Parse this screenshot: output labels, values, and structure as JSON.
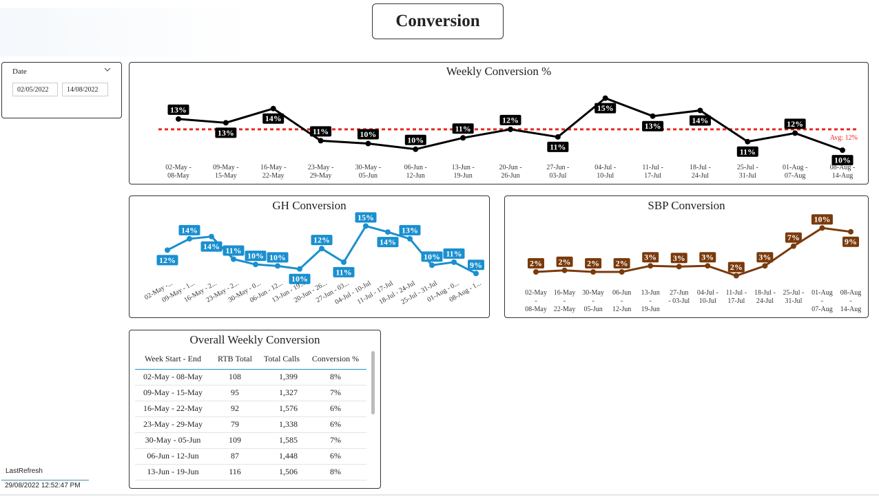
{
  "page": {
    "title": "Conversion"
  },
  "slicer": {
    "label": "Date",
    "start": "02/05/2022",
    "end": "14/08/2022"
  },
  "colors": {
    "weekly": "#000000",
    "avg": "#e8281e",
    "gh": "#1a8fcf",
    "sbp": "#7a3a0c"
  },
  "weekly_chart": {
    "title": "Weekly Conversion %",
    "avg_label": "Avg: 12%"
  },
  "gh_chart": {
    "title": "GH Conversion"
  },
  "sbp_chart": {
    "title": "SBP Conversion"
  },
  "table": {
    "title": "Overall Weekly Conversion",
    "columns": [
      "Week Start - End",
      "RTB Total",
      "Total Calls",
      "Conversion %"
    ],
    "rows": [
      [
        "02-May - 08-May",
        "108",
        "1,399",
        "8%"
      ],
      [
        "09-May - 15-May",
        "95",
        "1,327",
        "7%"
      ],
      [
        "16-May - 22-May",
        "92",
        "1,576",
        "6%"
      ],
      [
        "23-May - 29-May",
        "79",
        "1,338",
        "6%"
      ],
      [
        "30-May - 05-Jun",
        "109",
        "1,585",
        "7%"
      ],
      [
        "06-Jun - 12-Jun",
        "87",
        "1,448",
        "6%"
      ],
      [
        "13-Jun - 19-Jun",
        "116",
        "1,506",
        "8%"
      ]
    ]
  },
  "last_refresh": {
    "label": "LastRefresh",
    "value": "29/08/2022 12:52:47 PM"
  },
  "chart_data": [
    {
      "type": "line",
      "title": "Weekly Conversion %",
      "categories": [
        "02-May - 08-May",
        "09-May - 15-May",
        "16-May - 22-May",
        "23-May - 29-May",
        "30-May - 05-Jun",
        "06-Jun - 12-Jun",
        "13-Jun - 19-Jun",
        "20-Jun - 26-Jun",
        "27-Jun - 03-Jul",
        "04-Jul - 10-Jul",
        "11-Jul - 17-Jul",
        "18-Jul - 24-Jul",
        "25-Jul - 31-Jul",
        "01-Aug - 07-Aug",
        "08-Aug - 14-Aug"
      ],
      "cat_lines": [
        [
          "02-May -",
          "08-May"
        ],
        [
          "09-May -",
          "15-May"
        ],
        [
          "16-May -",
          "22-May"
        ],
        [
          "23-May -",
          "29-May"
        ],
        [
          "30-May -",
          "05-Jun"
        ],
        [
          "06-Jun -",
          "12-Jun"
        ],
        [
          "13-Jun -",
          "19-Jun"
        ],
        [
          "20-Jun -",
          "26-Jun"
        ],
        [
          "27-Jun -",
          "03-Jul"
        ],
        [
          "04-Jul -",
          "10-Jul"
        ],
        [
          "11-Jul -",
          "17-Jul"
        ],
        [
          "18-Jul -",
          "24-Jul"
        ],
        [
          "25-Jul -",
          "31-Jul"
        ],
        [
          "01-Aug -",
          "07-Aug"
        ],
        [
          "08-Aug -",
          "14-Aug"
        ]
      ],
      "values": [
        13.1,
        12.7,
        14.2,
        10.8,
        10.5,
        9.9,
        11.1,
        12.0,
        11.2,
        15.3,
        13.4,
        14.0,
        10.7,
        11.6,
        9.8
      ],
      "labels": [
        "13%",
        "13%",
        "14%",
        "11%",
        "10%",
        "10%",
        "11%",
        "12%",
        "11%",
        "15%",
        "13%",
        "14%",
        "11%",
        "12%",
        "10%"
      ],
      "label_pos": [
        "above",
        "below",
        "below",
        "above",
        "above",
        "above",
        "above",
        "above",
        "below",
        "below",
        "below",
        "below",
        "below",
        "above",
        "below"
      ],
      "average": 12.0,
      "ylim": [
        8.5,
        16
      ]
    },
    {
      "type": "line",
      "title": "GH Conversion",
      "categories": [
        "02-May -...",
        "09-May - 1...",
        "16-May - 2...",
        "23-May - 2...",
        "30-May - 0...",
        "06-Jun - 12...",
        "13-Jun - 19...",
        "20-Jun - 26...",
        "27-Jun - 03...",
        "04-Jul - 10-Jul",
        "11-Jul - 17-Jul",
        "18-Jul - 24-Jul",
        "25-Jul - 31-Jul",
        "01-Aug - 0...",
        "08-Aug - 1..."
      ],
      "values": [
        12.4,
        13.9,
        14.2,
        11.2,
        10.5,
        10.3,
        9.9,
        12.6,
        10.8,
        15.6,
        14.8,
        13.9,
        10.4,
        10.8,
        9.3
      ],
      "labels": [
        "12%",
        "14%",
        "14%",
        "11%",
        "10%",
        "10%",
        "10%",
        "12%",
        "11%",
        "15%",
        "14%",
        "13%",
        "10%",
        "11%",
        "9%"
      ],
      "label_pos": [
        "below",
        "above",
        "below",
        "above",
        "above",
        "above",
        "below",
        "above",
        "below",
        "above",
        "below",
        "above",
        "above",
        "above",
        "above"
      ],
      "ylim": [
        7.5,
        17
      ]
    },
    {
      "type": "line",
      "title": "SBP Conversion",
      "categories": [
        "02-May - 08-May",
        "16-May - 22-May",
        "30-May - 05-Jun",
        "06-Jun - 12-Jun",
        "13-Jun - 19-Jun",
        "27-Jun - 03-Jul",
        "04-Jul - 10-Jul",
        "11-Jul - 17-Jul",
        "18-Jul - 24-Jul",
        "25-Jul - 31-Jul",
        "01-Aug - 07-Aug",
        "08-Aug - 14-Aug"
      ],
      "cat_lines": [
        [
          "02-May",
          "-",
          "08-May"
        ],
        [
          "16-May",
          "-",
          "22-May"
        ],
        [
          "30-May",
          "-",
          "05-Jun"
        ],
        [
          "06-Jun",
          "-",
          "12-Jun"
        ],
        [
          "13-Jun",
          "-",
          "19-Jun"
        ],
        [
          "27-Jun",
          "- 03-Jul"
        ],
        [
          "04-Jul -",
          "10-Jul"
        ],
        [
          "11-Jul -",
          "17-Jul"
        ],
        [
          "18-Jul -",
          "24-Jul"
        ],
        [
          "25-Jul -",
          "31-Jul"
        ],
        [
          "01-Aug",
          "-",
          "07-Aug"
        ],
        [
          "08-Aug",
          "-",
          "14-Aug"
        ]
      ],
      "values": [
        2.0,
        2.2,
        2.0,
        2.0,
        2.8,
        2.7,
        2.8,
        1.5,
        2.8,
        5.4,
        7.8,
        7.3
      ],
      "labels": [
        "2%",
        "2%",
        "2%",
        "2%",
        "3%",
        "3%",
        "3%",
        "2%",
        "3%",
        "7%",
        "10%",
        "9%"
      ],
      "label_pos": [
        "above",
        "above",
        "above",
        "above",
        "above",
        "above",
        "above",
        "above",
        "above",
        "above",
        "above",
        "below"
      ],
      "ylim": [
        0,
        10
      ]
    }
  ]
}
